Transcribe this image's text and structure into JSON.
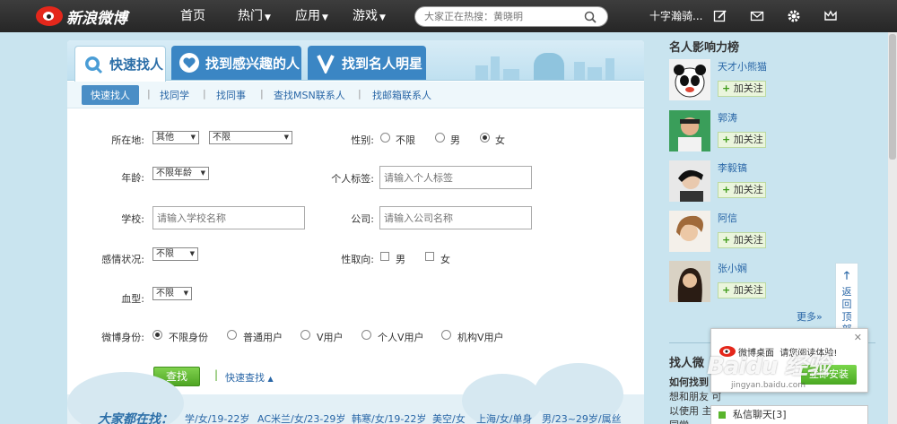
{
  "topbar": {
    "logo_text": "新浪微博",
    "nav": [
      {
        "label": "首页"
      },
      {
        "label": "热门"
      },
      {
        "label": "应用"
      },
      {
        "label": "游戏"
      }
    ],
    "search_placeholder": "大家正在热搜：黄晓明",
    "user_name": "十字瀚骑...",
    "accent": "#e4271b"
  },
  "tabs": [
    {
      "label": "快速找人"
    },
    {
      "label": "找到感兴趣的人"
    },
    {
      "label": "找到名人明星"
    }
  ],
  "subnav": [
    {
      "label": "快速找人"
    },
    {
      "label": "找同学"
    },
    {
      "label": "找同事"
    },
    {
      "label": "查找MSN联系人"
    },
    {
      "label": "找邮箱联系人"
    }
  ],
  "form": {
    "location_label": "所在地:",
    "location_province": "其他",
    "location_city": "不限",
    "gender_label": "性别:",
    "gender_options": [
      "不限",
      "男",
      "女"
    ],
    "gender_selected": "女",
    "age_label": "年龄:",
    "age_value": "不限年龄",
    "tag_label": "个人标签:",
    "tag_placeholder": "请输入个人标签",
    "school_label": "学校:",
    "school_placeholder": "请输入学校名称",
    "company_label": "公司:",
    "company_placeholder": "请输入公司名称",
    "relationship_label": "感情状况:",
    "relationship_value": "不限",
    "orientation_label": "性取向:",
    "orientation_options": [
      "男",
      "女"
    ],
    "blood_label": "血型:",
    "blood_value": "不限",
    "identity_label": "微博身份:",
    "identity_options": [
      "不限身份",
      "普通用户",
      "V用户",
      "个人V用户",
      "机构V用户"
    ],
    "identity_selected": "不限身份",
    "search_button": "查找",
    "quick_search": "快速查找"
  },
  "everyone": {
    "title": "大家都在找：",
    "links": [
      "学/女/19-22岁",
      "AC米兰/女/23-29岁",
      "韩寒/女/19-22岁",
      "美空/女",
      "上海/女/单身",
      "男/23~29岁/属丝"
    ]
  },
  "ranking": {
    "title": "名人影响力榜",
    "follow_label": "加关注",
    "celebs": [
      {
        "name": "天才小熊猫"
      },
      {
        "name": "郭涛"
      },
      {
        "name": "李毅镐"
      },
      {
        "name": "阿信"
      },
      {
        "name": "张小娴"
      }
    ],
    "more": "更多»"
  },
  "find_section": {
    "title": "找人微",
    "subtitle": "如何找到",
    "desc": "想和朋友 可以使用 主，同学"
  },
  "back_to_top": {
    "chars": [
      "返",
      "回",
      "顶",
      "部"
    ]
  },
  "popup": {
    "title": "微博桌面",
    "text": "请您阅读体验!",
    "button": "立即安装",
    "watermark": "Baidu 经验",
    "watermark_sub": "jingyan.baidu.com"
  },
  "chat": {
    "label": "私信聊天[3]"
  }
}
